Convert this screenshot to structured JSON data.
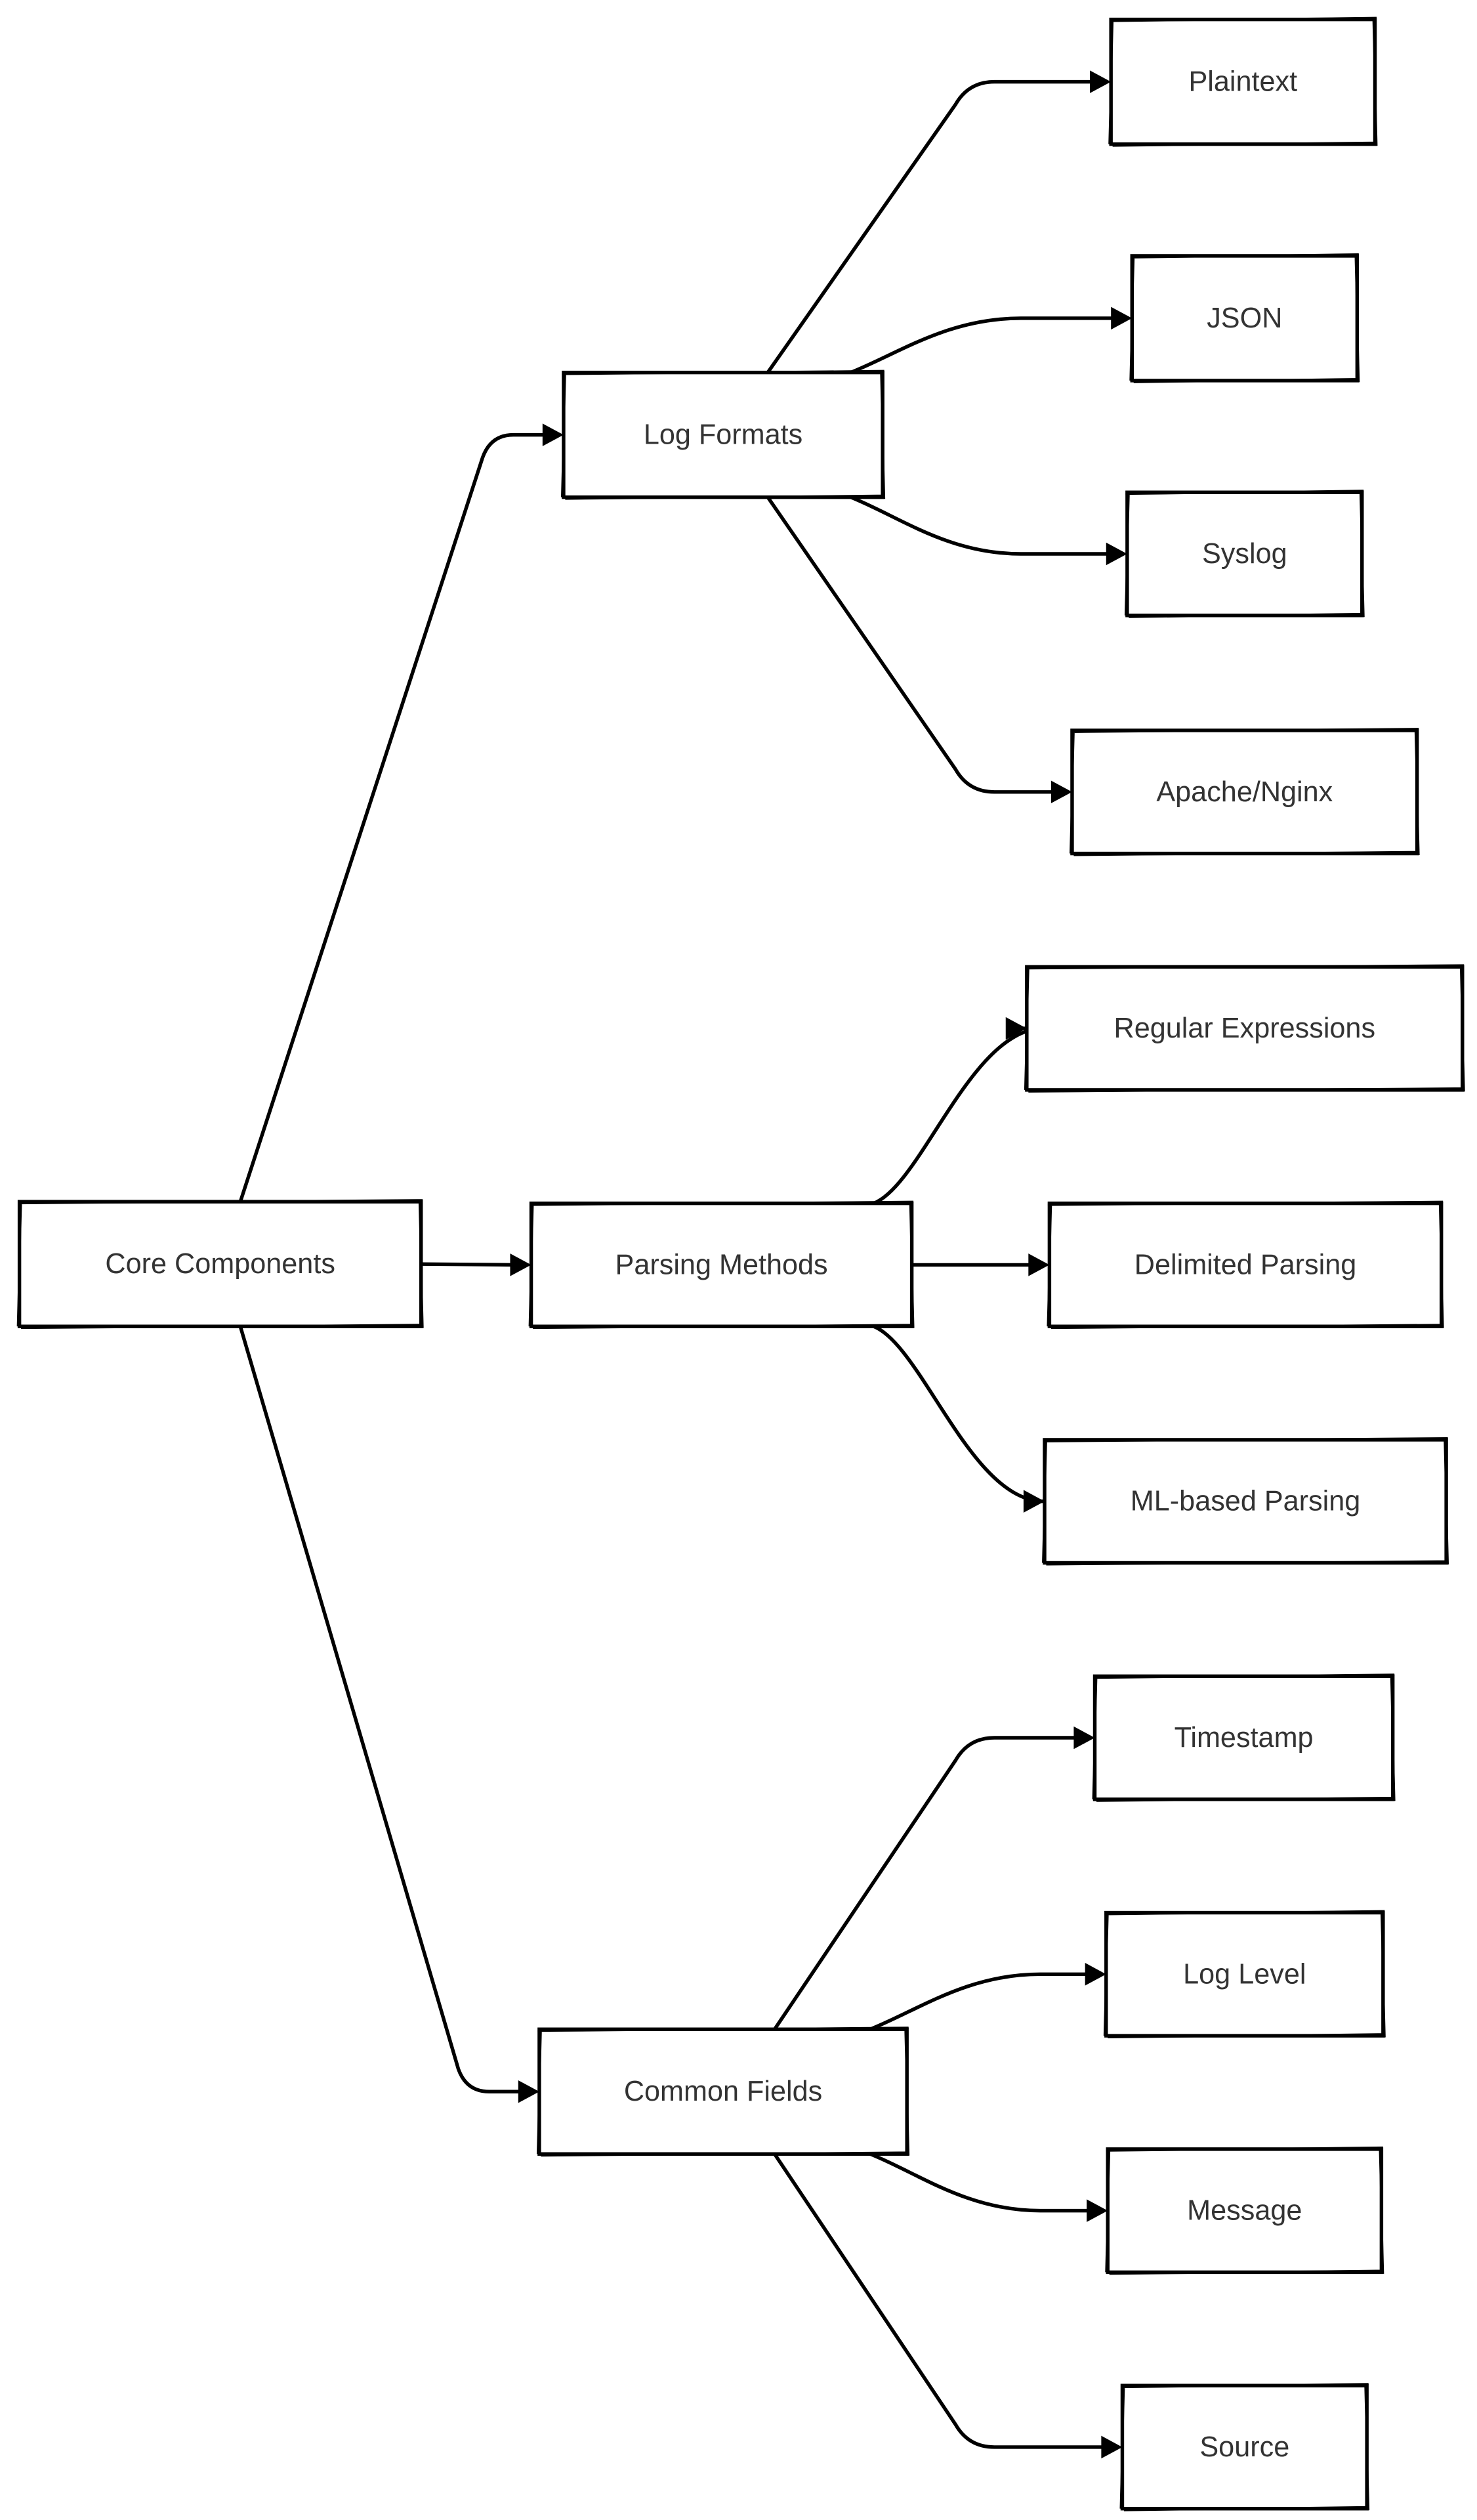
{
  "diagram": {
    "type": "mindmap-tree",
    "root": {
      "id": "core",
      "label": "Core Components"
    },
    "nodes": [
      {
        "id": "core",
        "label": "Core Components"
      },
      {
        "id": "formats",
        "label": "Log Formats",
        "parent": "core"
      },
      {
        "id": "parsing",
        "label": "Parsing Methods",
        "parent": "core"
      },
      {
        "id": "fields",
        "label": "Common Fields",
        "parent": "core"
      },
      {
        "id": "plaintext",
        "label": "Plaintext",
        "parent": "formats"
      },
      {
        "id": "json",
        "label": "JSON",
        "parent": "formats"
      },
      {
        "id": "syslog",
        "label": "Syslog",
        "parent": "formats"
      },
      {
        "id": "apache",
        "label": "Apache/Nginx",
        "parent": "formats"
      },
      {
        "id": "regex",
        "label": "Regular Expressions",
        "parent": "parsing"
      },
      {
        "id": "delimited",
        "label": "Delimited Parsing",
        "parent": "parsing"
      },
      {
        "id": "ml",
        "label": "ML-based Parsing",
        "parent": "parsing"
      },
      {
        "id": "timestamp",
        "label": "Timestamp",
        "parent": "fields"
      },
      {
        "id": "loglevel",
        "label": "Log Level",
        "parent": "fields"
      },
      {
        "id": "message",
        "label": "Message",
        "parent": "fields"
      },
      {
        "id": "source",
        "label": "Source",
        "parent": "fields"
      }
    ],
    "edges": [
      {
        "from": "core",
        "to": "formats"
      },
      {
        "from": "core",
        "to": "parsing"
      },
      {
        "from": "core",
        "to": "fields"
      },
      {
        "from": "formats",
        "to": "plaintext"
      },
      {
        "from": "formats",
        "to": "json"
      },
      {
        "from": "formats",
        "to": "syslog"
      },
      {
        "from": "formats",
        "to": "apache"
      },
      {
        "from": "parsing",
        "to": "regex"
      },
      {
        "from": "parsing",
        "to": "delimited"
      },
      {
        "from": "parsing",
        "to": "ml"
      },
      {
        "from": "fields",
        "to": "timestamp"
      },
      {
        "from": "fields",
        "to": "loglevel"
      },
      {
        "from": "fields",
        "to": "message"
      },
      {
        "from": "fields",
        "to": "source"
      }
    ],
    "colors": {
      "stroke": "#000000",
      "text": "#333333",
      "background": "#ffffff"
    }
  }
}
